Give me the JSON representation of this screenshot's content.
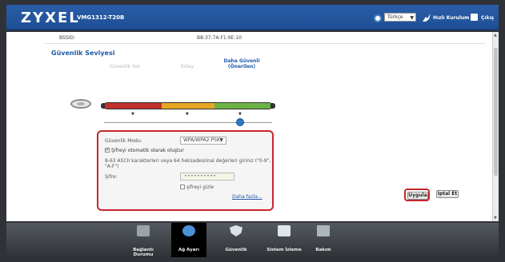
{
  "header": {
    "brand": "ZYXEL",
    "model": "VMG1312-T20B",
    "language": "Türkçe",
    "wizard_label": "Hızlı Kurulum",
    "exit_label": "Çıkış"
  },
  "wifi": {
    "bssid_label": "BSSID:",
    "bssid_value": "B8:37:7A:F1:9E:10"
  },
  "security": {
    "title": "Güvenlik Seviyesi",
    "levels": [
      "Güvenlik Yok",
      "Kolay",
      "Daha Güvenli (Önerilen)"
    ],
    "selected_level_index": 2,
    "mode_label": "Güvenlik Modu:",
    "mode_value": "WPA/WPA2-PSK",
    "auto_password_label": "Şifreyi otomatik olarak oluştur",
    "auto_password_checked": true,
    "hint": "8-63 ASCII karakterleri veya 64 heksadesimal değerleri giriniz (\"0-9\", \"A-F\")",
    "password_label": "Şifre:",
    "password_value": "••••••••••",
    "hide_password_label": "şifreyi gizle",
    "hide_password_checked": false,
    "more_link": "Daha fazla..."
  },
  "buttons": {
    "apply": "Uygula",
    "cancel": "İptal Et"
  },
  "nav": [
    {
      "label": "Bağlantı Durumu",
      "icon": "network-status-icon",
      "active": false
    },
    {
      "label": "Ağ Ayarı",
      "icon": "gear-icon",
      "active": true
    },
    {
      "label": "Güvenlik",
      "icon": "shield-icon",
      "active": false
    },
    {
      "label": "Sistem İzleme",
      "icon": "monitor-icon",
      "active": false
    },
    {
      "label": "Bakım",
      "icon": "tools-icon",
      "active": false
    }
  ],
  "colors": {
    "header_blue": "#2a5ea8",
    "highlight_red": "#c8262d",
    "level_red": "#c0302a",
    "level_yellow": "#e6a523",
    "level_green": "#6ab244"
  }
}
